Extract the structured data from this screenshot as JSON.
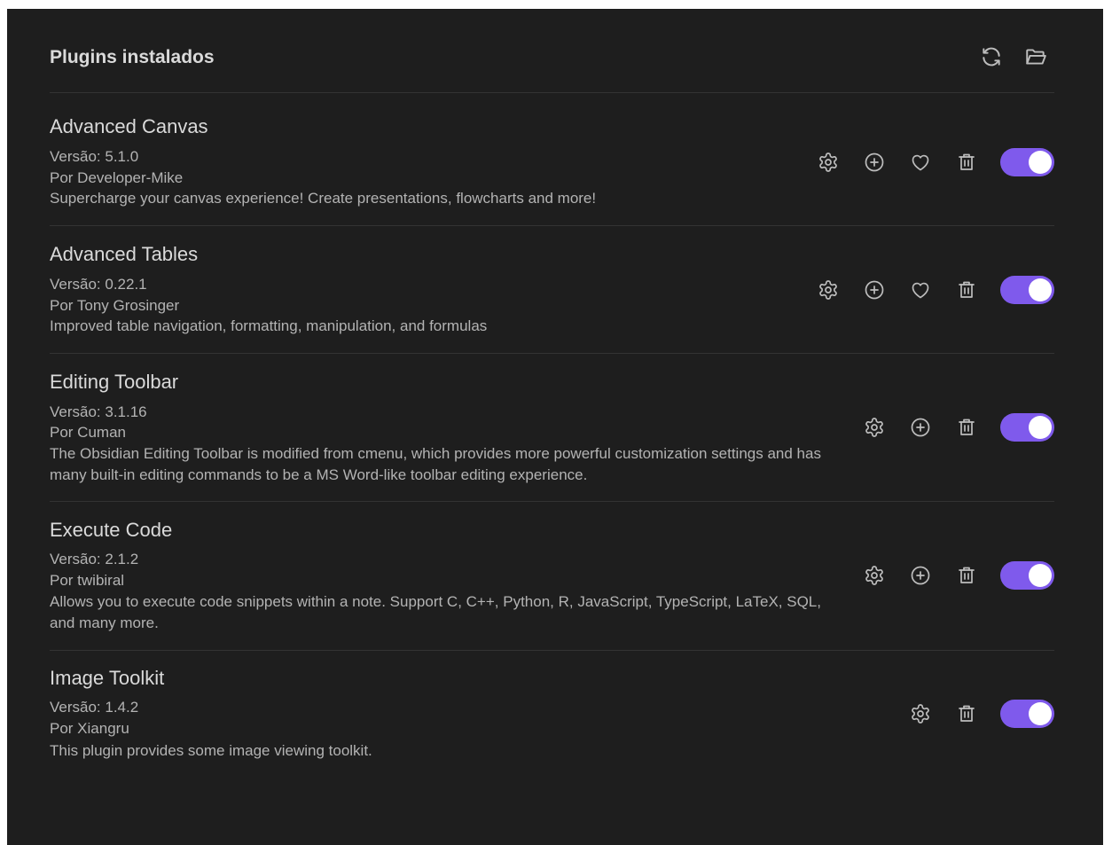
{
  "header": {
    "title": "Plugins instalados",
    "icons": [
      "refresh-icon",
      "folder-open-icon"
    ]
  },
  "colors": {
    "background": "#1e1e1e",
    "accent": "#7f5aec",
    "text_primary": "#dadada",
    "text_secondary": "#b3b3b3",
    "divider": "#333333"
  },
  "plugins": [
    {
      "name": "Advanced Canvas",
      "version": "Versão: 5.1.0",
      "author": "Por Developer-Mike",
      "description": "Supercharge your canvas experience! Create presentations, flowcharts and more!",
      "enabled": true,
      "actions": [
        "settings-icon",
        "add-hotkey-icon",
        "heart-icon",
        "trash-icon"
      ]
    },
    {
      "name": "Advanced Tables",
      "version": "Versão: 0.22.1",
      "author": "Por Tony Grosinger",
      "description": "Improved table navigation, formatting, manipulation, and formulas",
      "enabled": true,
      "actions": [
        "settings-icon",
        "add-hotkey-icon",
        "heart-icon",
        "trash-icon"
      ]
    },
    {
      "name": "Editing Toolbar",
      "version": "Versão: 3.1.16",
      "author": "Por Cuman",
      "description": "The Obsidian Editing Toolbar is modified from cmenu, which provides more powerful customization settings and has many built-in editing commands to be a MS Word-like toolbar editing experience.",
      "enabled": true,
      "actions": [
        "settings-icon",
        "add-hotkey-icon",
        "trash-icon"
      ]
    },
    {
      "name": "Execute Code",
      "version": "Versão: 2.1.2",
      "author": "Por twibiral",
      "description": "Allows you to execute code snippets within a note. Support C, C++, Python, R, JavaScript, TypeScript, LaTeX, SQL, and many more.",
      "enabled": true,
      "actions": [
        "settings-icon",
        "add-hotkey-icon",
        "trash-icon"
      ]
    },
    {
      "name": "Image Toolkit",
      "version": "Versão: 1.4.2",
      "author": "Por Xiangru",
      "description": "This plugin provides some image viewing toolkit.",
      "enabled": true,
      "actions": [
        "settings-icon",
        "trash-icon"
      ]
    }
  ]
}
